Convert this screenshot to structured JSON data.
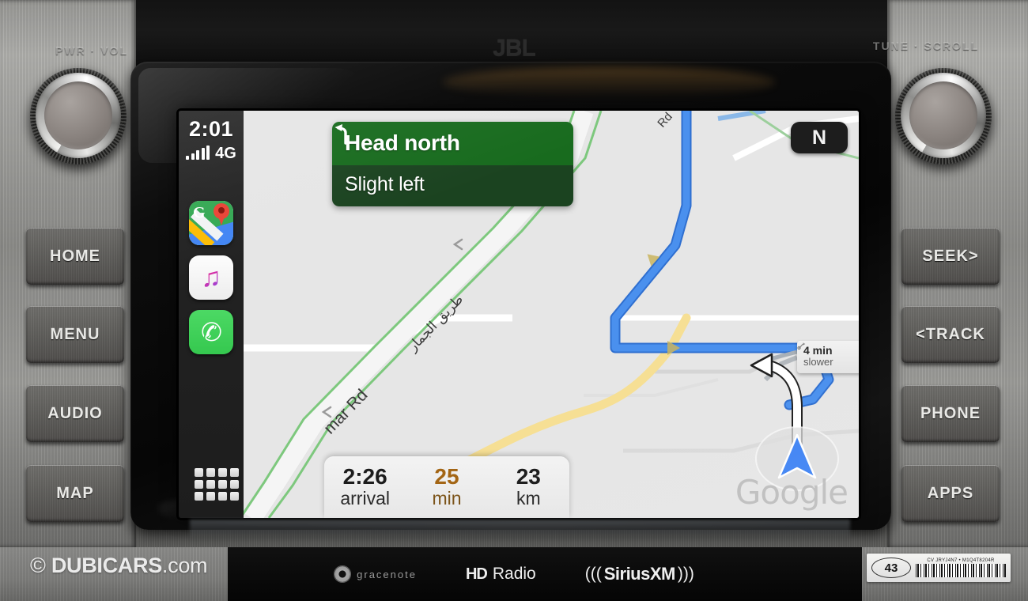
{
  "head_unit": {
    "brand_logo": "JBL",
    "knobs": [
      {
        "name": "power-volume-knob",
        "label": "PWR · VOL"
      },
      {
        "name": "tune-scroll-knob",
        "label": "TUNE · SCROLL"
      }
    ],
    "left_buttons": [
      {
        "name": "home-button",
        "label": "HOME"
      },
      {
        "name": "menu-button",
        "label": "MENU"
      },
      {
        "name": "audio-button",
        "label": "AUDIO"
      },
      {
        "name": "map-button",
        "label": "MAP"
      }
    ],
    "right_buttons": [
      {
        "name": "seek-button",
        "label": "SEEK>"
      },
      {
        "name": "track-button",
        "label": "<TRACK"
      },
      {
        "name": "phone-button",
        "label": "PHONE"
      },
      {
        "name": "apps-button",
        "label": "APPS"
      }
    ],
    "bottom_brands": [
      {
        "name": "gracenote-logo",
        "label": "gracenote"
      },
      {
        "name": "hd-radio-logo",
        "badge": "HD",
        "label": "Radio"
      },
      {
        "name": "siriusxm-logo",
        "label": "SiriusXM",
        "left_waves": "(((",
        "right_waves": ")))"
      }
    ]
  },
  "carplay": {
    "status": {
      "time": "2:01",
      "network": "4G",
      "signal_bars": 5
    },
    "dock_apps": [
      {
        "name": "app-icon-google-maps",
        "label": "Google Maps",
        "icon": "maps-icon",
        "glyph": "G"
      },
      {
        "name": "app-icon-music",
        "label": "Music",
        "icon": "music-note-icon",
        "glyph": "♫"
      },
      {
        "name": "app-icon-phone",
        "label": "Phone",
        "icon": "phone-handset-icon",
        "glyph": "✆"
      }
    ],
    "app_grid_button": {
      "name": "app-launcher-grid",
      "label": "Apps"
    }
  },
  "navigation": {
    "banner": {
      "primary_instruction": "Head north",
      "next_instruction": "Slight left",
      "maneuver_icon": "slight-left-arrow-icon",
      "primary_color": "#186b1e",
      "secondary_color": "#1b4320"
    },
    "compass": {
      "label": "N",
      "name": "compass-north-badge"
    },
    "eta": [
      {
        "value": "2:26",
        "label": "arrival",
        "highlight": false
      },
      {
        "value": "25",
        "label": "min",
        "highlight": true
      },
      {
        "value": "23",
        "label": "km",
        "highlight": false
      }
    ],
    "traffic_tooltip": {
      "line1": "4 min",
      "line2": "slower",
      "icon": "route-alternative-icon"
    },
    "map": {
      "attribution": "Google",
      "road_labels": [
        {
          "text": "mar Rd",
          "name": "road-label-mar-rd"
        },
        {
          "text": "طريق الجمار",
          "name": "road-label-arabic"
        },
        {
          "text": "Rd",
          "name": "road-label-rd-top"
        }
      ],
      "route_color": "#4a90ee",
      "alt_route_color": "#aaaaaa",
      "vehicle_marker": "navigation-arrow-marker",
      "background_color": "#e6e6e6"
    }
  },
  "overlays": {
    "watermark": {
      "copyright": "©",
      "brand": "DUBICARS",
      "tld": ".com"
    },
    "sticker": {
      "number": "43",
      "code": "CV JRYJ4N7 • M1Q4T8204R"
    }
  }
}
